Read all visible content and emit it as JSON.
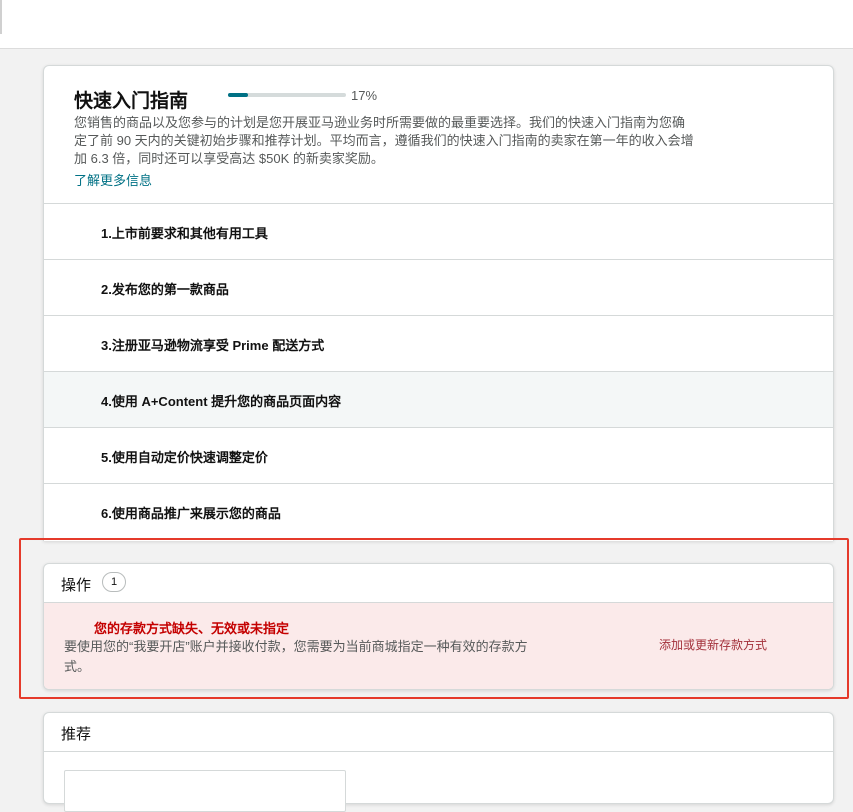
{
  "guide": {
    "title": "快速入门指南",
    "progress_percent": 17,
    "progress_text": "17%",
    "description": "您销售的商品以及您参与的计划是您开展亚马逊业务时所需要做的最重要选择。我们的快速入门指南为您确定了前 90 天内的关键初始步骤和推荐计划。平均而言，遵循我们的快速入门指南的卖家在第一年的收入会增加 6.3 倍，同时还可以享受高达 $50K 的新卖家奖励。",
    "learn_more": "了解更多信息",
    "steps": [
      {
        "label": "1.上市前要求和其他有用工具"
      },
      {
        "label": "2.发布您的第一款商品"
      },
      {
        "label": "3.注册亚马逊物流享受 Prime 配送方式"
      },
      {
        "label": "4.使用 A+Content 提升您的商品页面内容"
      },
      {
        "label": "5.使用自动定价快速调整定价"
      },
      {
        "label": "6.使用商品推广来展示您的商品"
      }
    ]
  },
  "actions": {
    "title": "操作",
    "count": "1",
    "alert": {
      "title": "您的存款方式缺失、无效或未指定",
      "body": "要使用您的“我要开店”账户并接收付款，您需要为当前商城指定一种有效的存款方式。",
      "link": "添加或更新存款方式"
    }
  },
  "recommend": {
    "title": "推荐"
  },
  "colors": {
    "accent": "#007185",
    "alert_bg": "#fbeaea",
    "alert_title": "#c40000",
    "highlight_border": "#e53a2b"
  }
}
